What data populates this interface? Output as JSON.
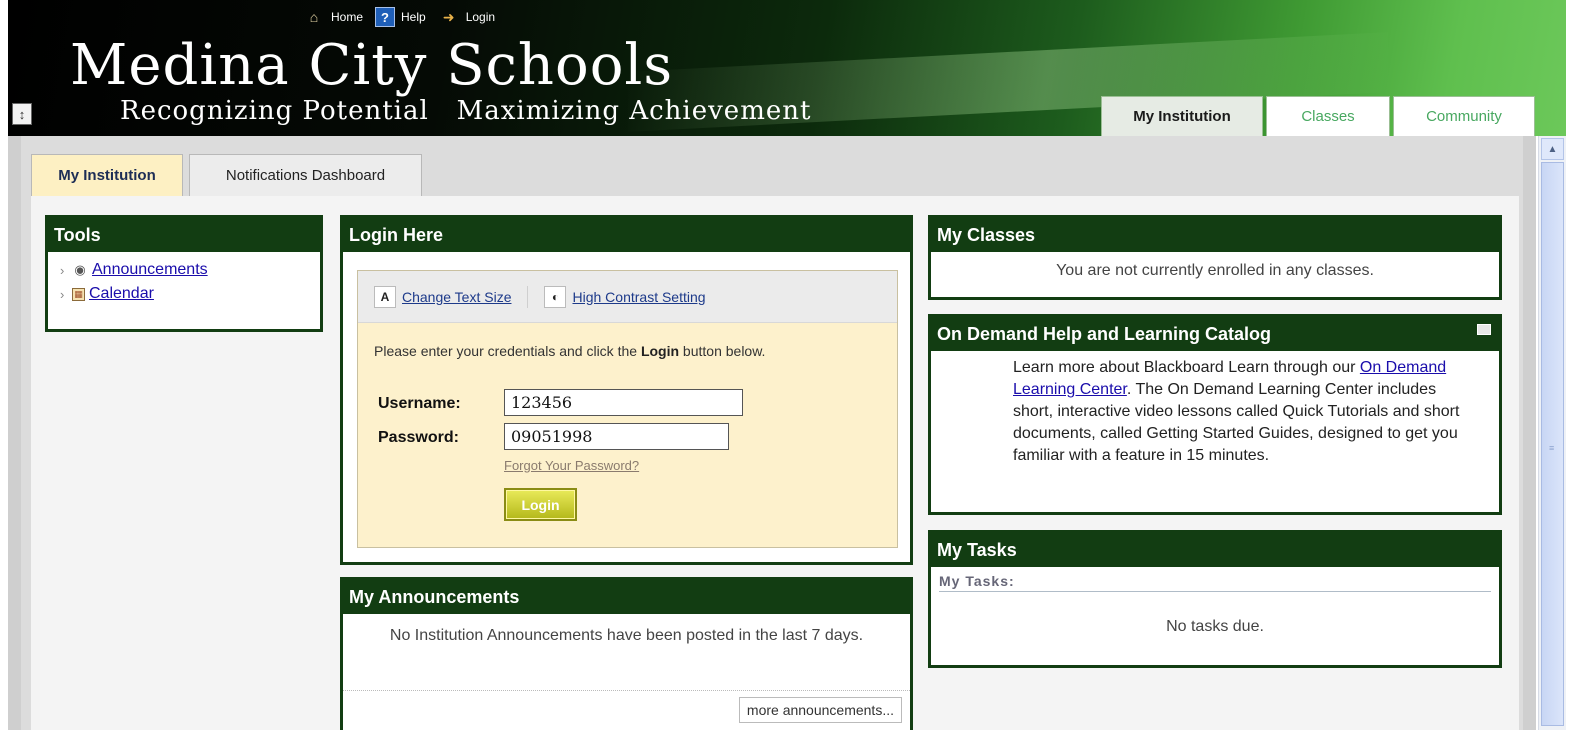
{
  "header": {
    "top_links": [
      {
        "label": "Home",
        "icon": "home-icon"
      },
      {
        "label": "Help",
        "icon": "help-icon"
      },
      {
        "label": "Login",
        "icon": "login-icon"
      }
    ],
    "title": "Medina City Schools",
    "tagline": "Recognizing Potential   Maximizing Achievement",
    "main_tabs": [
      "My Institution",
      "Classes",
      "Community"
    ]
  },
  "sub_tabs": [
    "My Institution",
    "Notifications Dashboard"
  ],
  "tools": {
    "title": "Tools",
    "items": [
      {
        "label": "Announcements",
        "icon": "speaker-icon"
      },
      {
        "label": "Calendar",
        "icon": "calendar-icon"
      }
    ]
  },
  "login": {
    "title": "Login Here",
    "change_text_size": "Change Text Size",
    "high_contrast": "High Contrast Setting",
    "instructions_pre": "Please enter your credentials and click the ",
    "instructions_bold": "Login",
    "instructions_post": " button below.",
    "username_label": "Username:",
    "username_value": "123456",
    "password_label": "Password:",
    "password_value": "09051998",
    "forgot": "Forgot Your Password?",
    "button": "Login"
  },
  "announcements": {
    "title": "My Announcements",
    "text": "No Institution Announcements have been posted in the last 7 days.",
    "more": "more announcements..."
  },
  "classes": {
    "title": "My Classes",
    "text": "You are not currently enrolled in any classes."
  },
  "on_demand": {
    "title": "On Demand Help and Learning Catalog",
    "text_pre": "Learn more about Blackboard Learn through our ",
    "link": "On Demand Learning Center",
    "text_post": ". The On Demand Learning Center includes short, interactive video lessons called Quick Tutorials and short documents, called Getting Started Guides, designed to get you familiar with a feature in 15 minutes."
  },
  "tasks": {
    "title": "My Tasks",
    "subtitle": "My Tasks:",
    "text": "No tasks due."
  },
  "colors": {
    "module_header": "#123d12",
    "login_panel": "#fdf1cc",
    "link": "#1a0dab",
    "tab_green": "#48a860"
  }
}
